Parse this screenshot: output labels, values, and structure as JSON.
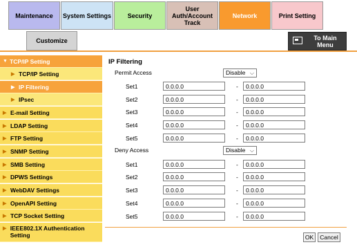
{
  "tabs": {
    "maintenance": "Maintenance",
    "system": "System Settings",
    "security": "Security",
    "auth": "User Auth/Account Track",
    "network": "Network",
    "print": "Print Setting",
    "customize": "Customize"
  },
  "main_menu": "To Main Menu",
  "sidebar": {
    "tcpip_group": "TCP/IP Setting",
    "tcpip_sub": "TCP/IP Setting",
    "ip_filtering": "IP Filtering",
    "ipsec": "IPsec",
    "email": "E-mail Setting",
    "ldap": "LDAP Setting",
    "ftp": "FTP Setting",
    "snmp": "SNMP Setting",
    "smb": "SMB Setting",
    "dpws": "DPWS Settings",
    "webdav": "WebDAV Settings",
    "openapi": "OpenAPI Setting",
    "tcp_socket": "TCP Socket Setting",
    "ieee": "IEEE802.1X Authentication Setting"
  },
  "ip_filtering": {
    "title": "IP Filtering",
    "permit_label": "Permit Access",
    "permit_value": "Disable",
    "deny_label": "Deny Access",
    "deny_value": "Disable",
    "dash": "-",
    "permit": {
      "set1": {
        "label": "Set1",
        "from": "0.0.0.0",
        "to": "0.0.0.0"
      },
      "set2": {
        "label": "Set2",
        "from": "0.0.0.0",
        "to": "0.0.0.0"
      },
      "set3": {
        "label": "Set3",
        "from": "0.0.0.0",
        "to": "0.0.0.0"
      },
      "set4": {
        "label": "Set4",
        "from": "0.0.0.0",
        "to": "0.0.0.0"
      },
      "set5": {
        "label": "Set5",
        "from": "0.0.0.0",
        "to": "0.0.0.0"
      }
    },
    "deny": {
      "set1": {
        "label": "Set1",
        "from": "0.0.0.0",
        "to": "0.0.0.0"
      },
      "set2": {
        "label": "Set2",
        "from": "0.0.0.0",
        "to": "0.0.0.0"
      },
      "set3": {
        "label": "Set3",
        "from": "0.0.0.0",
        "to": "0.0.0.0"
      },
      "set4": {
        "label": "Set4",
        "from": "0.0.0.0",
        "to": "0.0.0.0"
      },
      "set5": {
        "label": "Set5",
        "from": "0.0.0.0",
        "to": "0.0.0.0"
      }
    }
  },
  "buttons": {
    "ok": "OK",
    "cancel": "Cancel"
  },
  "icons": {
    "dropdown": "chevron-down-icon",
    "arrow": "triangle-right-icon",
    "main_menu": "home-screen-icon"
  },
  "colors": {
    "accent": "#f7a33b",
    "nav": "#fadc5c"
  }
}
